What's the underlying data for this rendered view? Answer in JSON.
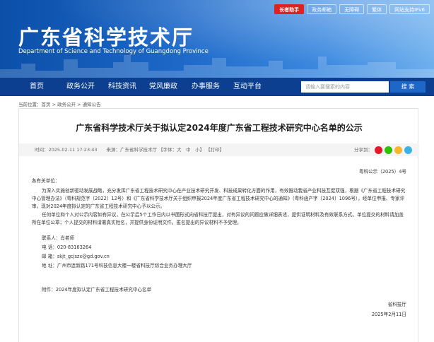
{
  "header": {
    "title": "广东省科学技术厅",
    "subtitle": "Department of Science and Technology of Guangdong Province",
    "top_links": [
      "长者助手",
      "政务邮箱",
      "无障碍",
      "繁体",
      "网站支持IPv6"
    ]
  },
  "nav": {
    "items": [
      "首页",
      "政务公开",
      "科技资讯",
      "党风廉政",
      "办事服务",
      "互动平台"
    ],
    "search_placeholder": "请输入要搜索的内容",
    "search_button": "搜 索"
  },
  "breadcrumb": "当前位置：首页 > 政务公开 > 通知公告",
  "article": {
    "title": "广东省科学技术厅关于拟认定2024年度广东省工程技术研究中心名单的公示",
    "meta": "时间：2025-02-11 17:23:43　　来源：广东省科学技术厅 【字体：大　中　小】 【打印】",
    "share_label": "分享到：",
    "doc_no": "粤科公示（2025）4号",
    "salutation": "各有关单位：",
    "para1": "为深入实施创新驱动发展战略，充分发挥广东省工程技术研究中心在产业技术研究开发、科技成果转化方面的作用，有效推动我省产业科技互促双强，根据《广东省工程技术研究中心管理办法》（粤科规范字〔2022〕12号）和《广东省科学技术厅关于组织申报2024年度广东省工程技术研究中心的通知》（粤科函产字〔2024〕1096号），经单位申报、专家评审，现对2024年度拟认定的广东省工程技术研究中心予以公示。",
    "para2": "任何单位和个人对公示内容如有异议，在公示后5个工作日内以书面形式向省科技厅提出，对有异议的问题应做详细表述，提供证明材料及有效联系方式。单位提交的材料请加盖所在单位公章；个人提交的材料请署真实姓名，并提供身份证明文件。匿名提出的异议材料不予受理。",
    "contact": "联系人：肖老师",
    "phone": "电  话：020-83163264",
    "email": "邮  箱：skjt_gcjszx@gd.gov.cn",
    "address": "地  址：广州市连新路171号科技信息大楼一楼省科技厅综合业务办理大厅",
    "attachment": "附件：2024年度拟认定广东省工程技术研究中心名单",
    "signature": "省科技厅",
    "date": "2025年2月11日"
  },
  "colors": {
    "nav": "#0c3f8f",
    "elder_badge": "#dd2222"
  }
}
